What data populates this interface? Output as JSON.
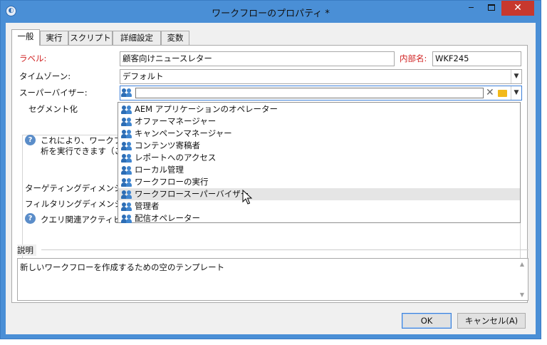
{
  "window": {
    "title": "ワークフローのプロパティ *",
    "min_label": "‒",
    "close_label": "✕"
  },
  "tabs": [
    {
      "label": "一般"
    },
    {
      "label": "実行"
    },
    {
      "label": "スクリプト"
    },
    {
      "label": "詳細設定"
    },
    {
      "label": "変数"
    }
  ],
  "form": {
    "label_caption": "ラベル:",
    "label_value": "顧客向けニュースレター",
    "internal_name_caption": "内部名:",
    "internal_name_value": "WKF245",
    "timezone_caption": "タイムゾーン:",
    "timezone_value": "デフォルト",
    "supervisor_caption": "スーパーバイザー:",
    "supervisor_value": ""
  },
  "segmentation": {
    "title": "セグメント化",
    "info_line1": "これにより、ワークフロー",
    "info_line2": "析を実行できます（これ",
    "targeting_caption": "ターゲティングディメンション:",
    "filtering_caption": "フィルタリングディメンション:",
    "query_info": "クエリ関連アクティビティ"
  },
  "dropdown": {
    "options": [
      {
        "label": "AEM アプリケーションのオペレーター"
      },
      {
        "label": "オファーマネージャー"
      },
      {
        "label": "キャンペーンマネージャー"
      },
      {
        "label": "コンテンツ寄稿者"
      },
      {
        "label": "レポートへのアクセス"
      },
      {
        "label": "ローカル管理"
      },
      {
        "label": "ワークフローの実行"
      },
      {
        "label": "ワークフロースーパーバイザー"
      },
      {
        "label": "管理者"
      },
      {
        "label": "配信オペレーター"
      }
    ],
    "hovered_index": 7
  },
  "description": {
    "title": "説明",
    "value": "新しいワークフローを作成するための空のテンプレート"
  },
  "buttons": {
    "ok": "OK",
    "cancel": "キャンセル(A)"
  },
  "colors": {
    "title_bar": "#4a8fd6",
    "close_button": "#c7382e",
    "required_label": "#d02020",
    "folder_icon": "#f2b91b"
  }
}
